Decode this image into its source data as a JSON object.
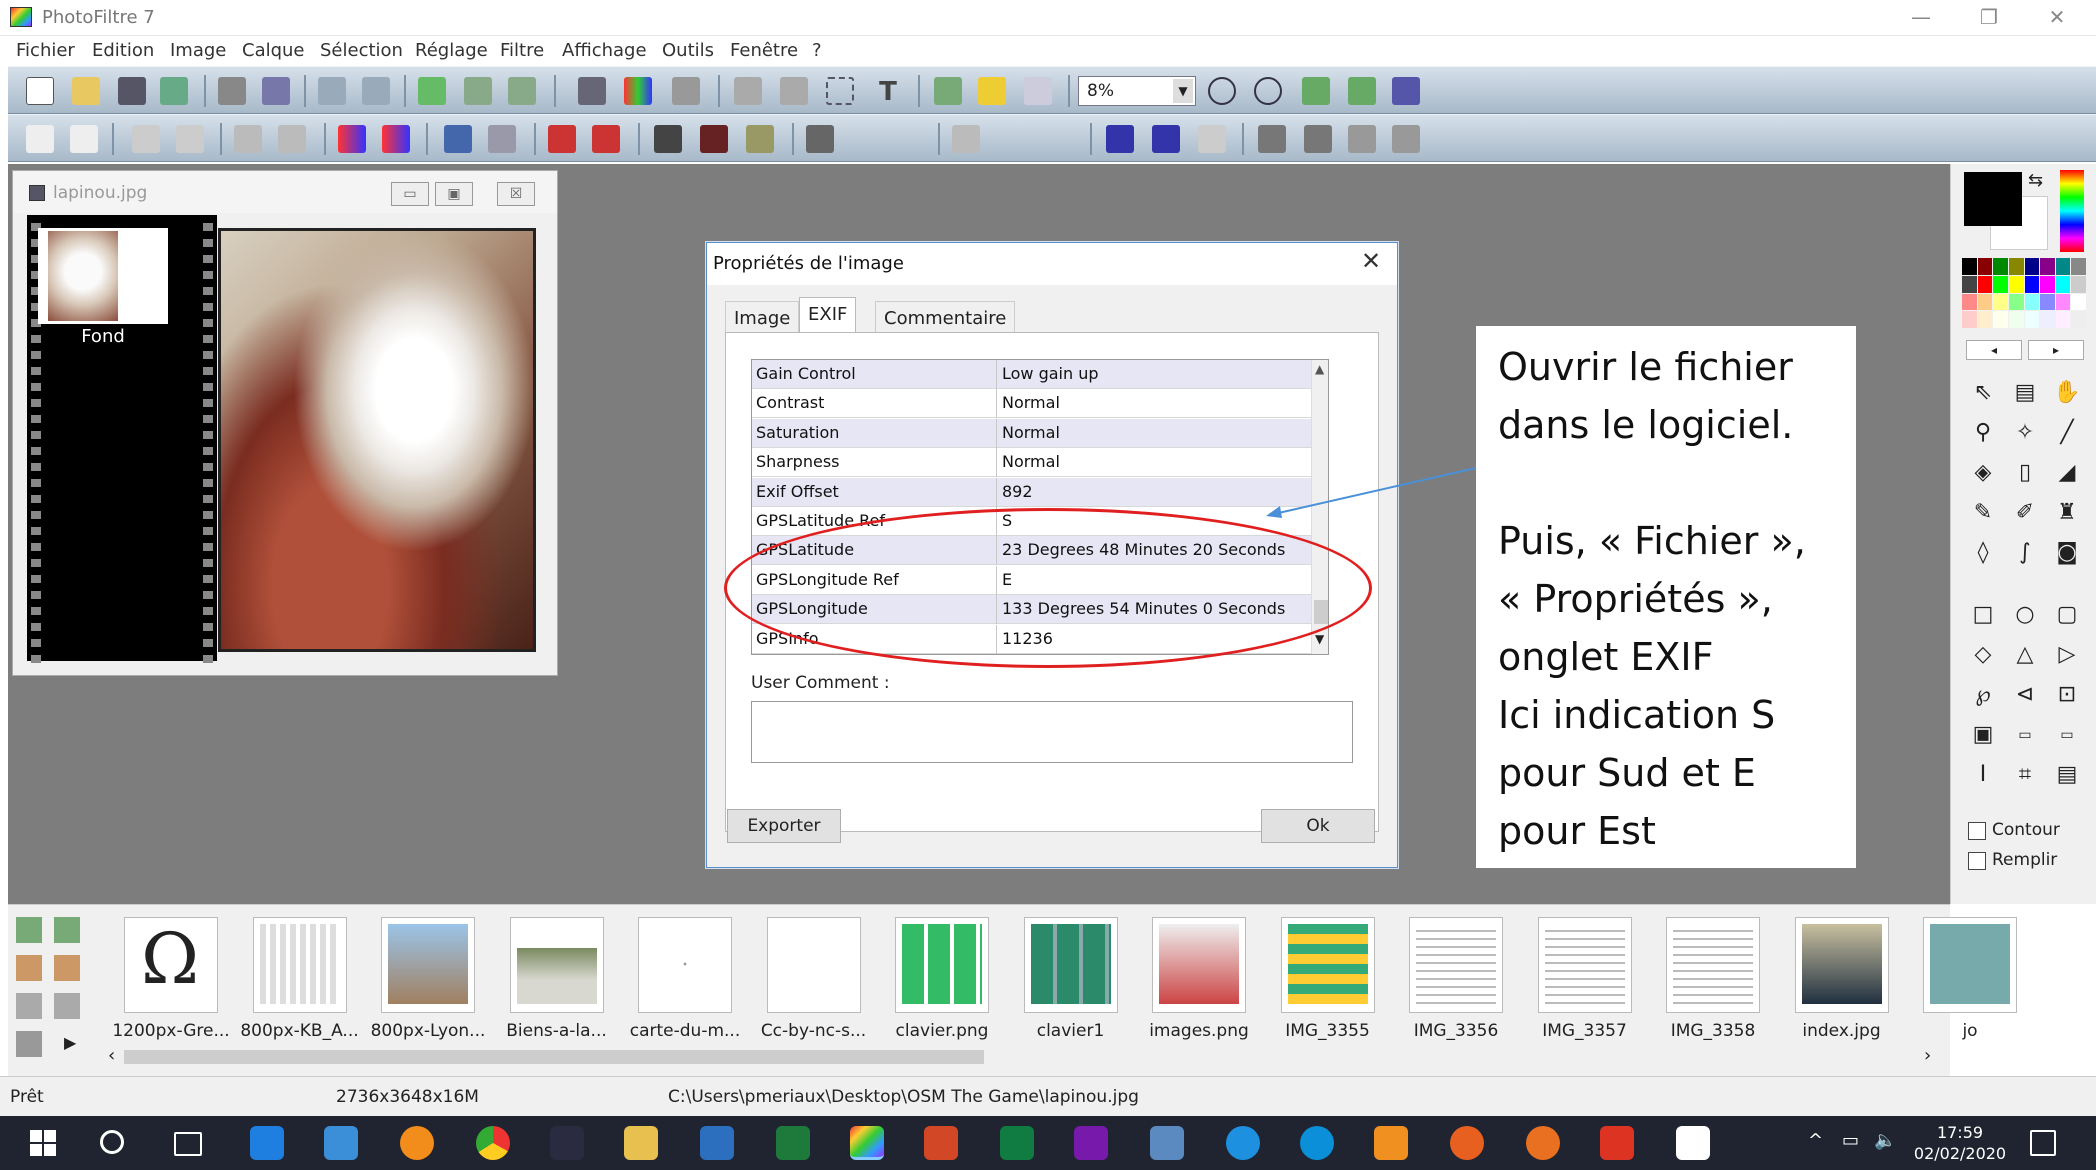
{
  "window": {
    "title": "PhotoFiltre 7",
    "minimize": "—",
    "restore": "❐",
    "close": "✕"
  },
  "menu": [
    "Fichier",
    "Edition",
    "Image",
    "Calque",
    "Sélection",
    "Réglage",
    "Filtre",
    "Affichage",
    "Outils",
    "Fenêtre",
    "?"
  ],
  "toolbar": {
    "zoom_value": "8%"
  },
  "document": {
    "title": "lapinou.jpg",
    "layer_label": "Fond",
    "btn_min": "▭",
    "btn_max": "▣",
    "btn_close": "☒"
  },
  "dialog": {
    "title": "Propriétés de l'image",
    "close": "✕",
    "tabs": [
      "Image",
      "EXIF",
      "Commentaire"
    ],
    "rows": [
      {
        "key": "Gain Control",
        "value": "Low gain up"
      },
      {
        "key": "Contrast",
        "value": "Normal"
      },
      {
        "key": "Saturation",
        "value": "Normal"
      },
      {
        "key": "Sharpness",
        "value": "Normal"
      },
      {
        "key": "Exif Offset",
        "value": "892"
      },
      {
        "key": "GPSLatitude Ref",
        "value": "S"
      },
      {
        "key": "GPSLatitude",
        "value": "23 Degrees 48 Minutes 20 Seconds"
      },
      {
        "key": "GPSLongitude Ref",
        "value": "E"
      },
      {
        "key": "GPSLongitude",
        "value": "133 Degrees 54 Minutes 0 Seconds"
      },
      {
        "key": "GPSInfo",
        "value": "11236"
      }
    ],
    "user_comment_label": "User Comment :",
    "export_button": "Exporter",
    "ok_button": "Ok"
  },
  "callout": {
    "lines": [
      "Ouvrir le fichier",
      "dans le logiciel.",
      "",
      "Puis, « Fichier »,",
      "« Propriétés »,",
      "onglet EXIF",
      "Ici indication S",
      "pour Sud et E",
      "pour Est"
    ]
  },
  "rightpanel": {
    "contour_label": "Contour",
    "remplir_label": "Remplir",
    "nav_prev": "◂",
    "nav_next": "▸"
  },
  "browser": {
    "items": [
      "1200px-Gre...",
      "800px-KB_A...",
      "800px-Lyon...",
      "Biens-a-la...",
      "carte-du-m...",
      "Cc-by-nc-s...",
      "clavier.png",
      "clavier1",
      "images.png",
      "IMG_3355",
      "IMG_3356",
      "IMG_3357",
      "IMG_3358",
      "index.jpg",
      "jo"
    ],
    "omega_glyph": "Ω",
    "scroll_left": "‹",
    "scroll_right": "›",
    "expand_arrow": "▶"
  },
  "status": {
    "state": "Prêt",
    "dimensions": "2736x3648x16M",
    "path": "C:\\Users\\pmeriaux\\Desktop\\OSM The Game\\lapinou.jpg"
  },
  "taskbar": {
    "time": "17:59",
    "date": "02/02/2020",
    "tray_chevron": "^"
  },
  "colors": {
    "accent_red": "#e02020",
    "callout_arrow": "#4a90d9",
    "toolbar_blue": "#a8b9c9"
  }
}
